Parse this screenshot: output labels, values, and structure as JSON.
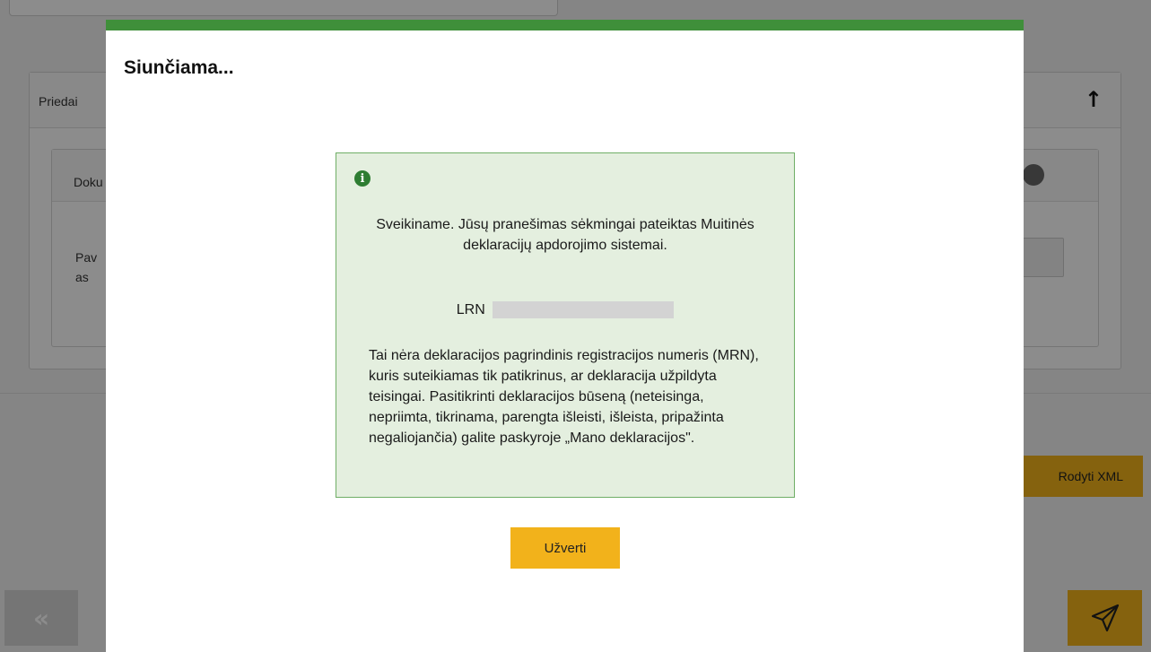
{
  "background": {
    "panel_title": "Priedai",
    "subcard_title": "Doku",
    "field_label_line1": "Pav",
    "field_label_line2": "as",
    "show_xml_label": "Rodyti XML",
    "prev_glyph": "«"
  },
  "modal": {
    "title": "Siunčiama...",
    "message": "Sveikiname. Jūsų pranešimas sėkmingai pateiktas Muitinės deklaracijų apdorojimo sistemai.",
    "lrn_label": "LRN",
    "note": "Tai nėra deklaracijos pagrindinis registracijos numeris (MRN), kuris suteikiamas tik patikrinus, ar deklaracija užpildyta teisingai. Pasitikrinti deklaracijos būseną (neteisinga, nepriimta, tikrinama, parengta išleisti, išleista, pripažinta negaliojančia) galite paskyroje „Mano deklaracijos\".",
    "close_label": "Užverti"
  },
  "colors": {
    "accent_green": "#3f8f3a",
    "info_bg": "#e4efdf",
    "button_yellow": "#f2b21b"
  }
}
